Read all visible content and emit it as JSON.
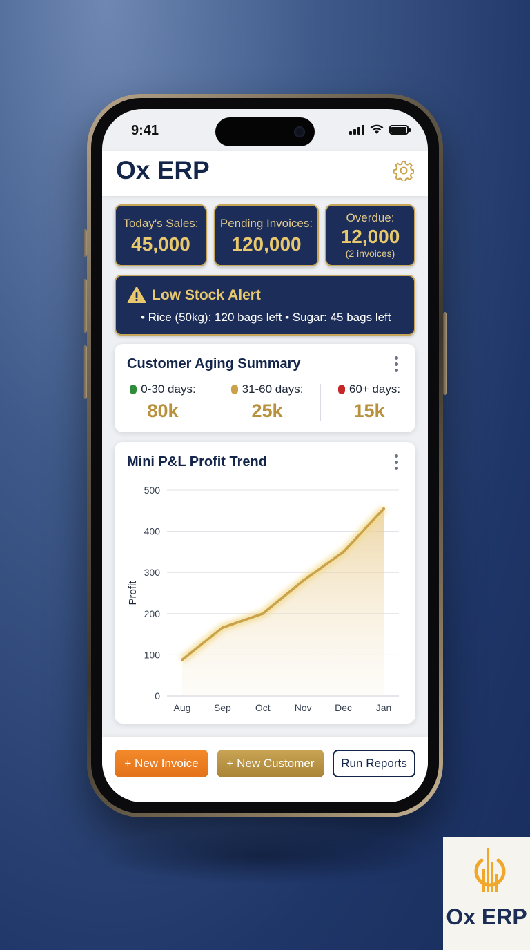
{
  "status_bar": {
    "time": "9:41"
  },
  "header": {
    "title": "Ox ERP",
    "settings_icon": "gear-icon"
  },
  "stats": [
    {
      "label": "Today's Sales:",
      "value": "45,000"
    },
    {
      "label": "Pending Invoices:",
      "value": "120,000"
    },
    {
      "label": "Overdue:",
      "value": "12,000",
      "sub": "(2 invoices)"
    }
  ],
  "alert": {
    "icon": "warning-icon",
    "title": "Low Stock Alert",
    "text": "• Rice (50kg): 120 bags left • Sugar: 45 bags left"
  },
  "aging": {
    "title": "Customer Aging Summary",
    "buckets": [
      {
        "label": "0-30 days:",
        "value": "80k",
        "color": "#2e8b3a"
      },
      {
        "label": "31-60 days:",
        "value": "25k",
        "color": "#c9a24a"
      },
      {
        "label": "60+ days:",
        "value": "15k",
        "color": "#c62828"
      }
    ]
  },
  "profit_card": {
    "title": "Mini P&L Profit Trend"
  },
  "chart_data": {
    "type": "line",
    "title": "Mini P&L Profit Trend",
    "ylabel": "Profit",
    "xlabel": "",
    "categories": [
      "Aug",
      "Sep",
      "Oct",
      "Nov",
      "Dec",
      "Jan"
    ],
    "values": [
      88,
      166,
      200,
      280,
      350,
      455
    ],
    "ylim": [
      0,
      500
    ],
    "yticks": [
      0,
      100,
      200,
      300,
      400,
      500
    ],
    "grid": true,
    "line_color": "#c9a24a",
    "fill": "area"
  },
  "actions": {
    "new_invoice": "+ New Invoice",
    "new_customer": "+ New Customer",
    "run_reports": "Run Reports"
  },
  "logo": {
    "text": "Ox ERP"
  },
  "colors": {
    "navy": "#1b2d58",
    "gold": "#c6a75a",
    "orange": "#f38a2b"
  }
}
